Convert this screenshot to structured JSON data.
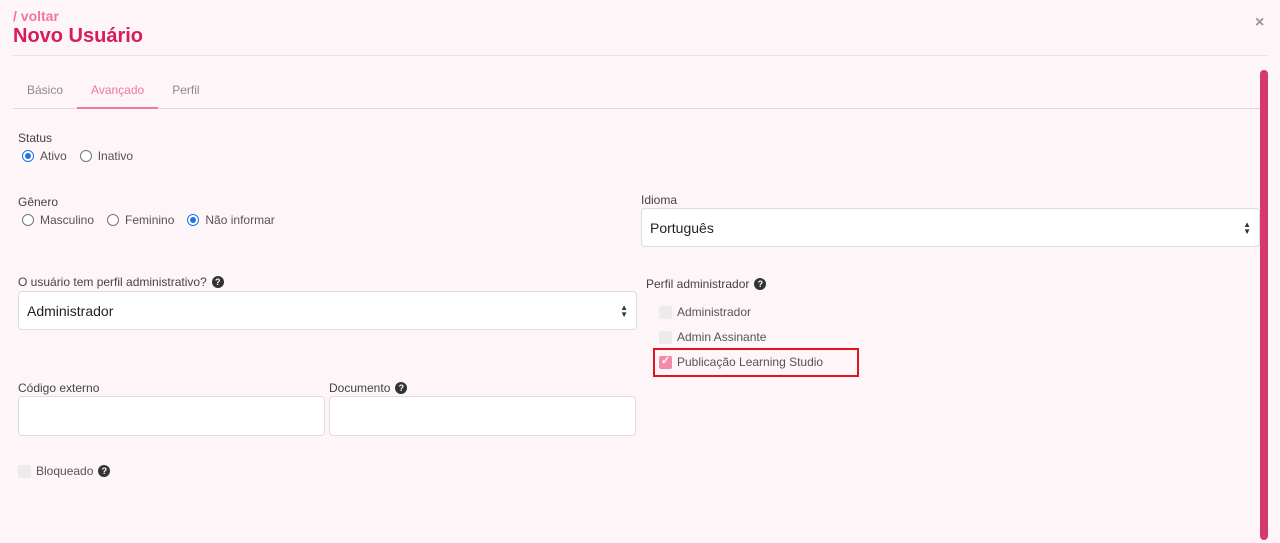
{
  "header": {
    "back_label": "/ voltar",
    "title": "Novo Usuário",
    "close_label": "×"
  },
  "tabs": [
    {
      "label": "Básico",
      "active": false
    },
    {
      "label": "Avançado",
      "active": true
    },
    {
      "label": "Perfil",
      "active": false
    }
  ],
  "status": {
    "label": "Status",
    "options": [
      {
        "label": "Ativo",
        "checked": true
      },
      {
        "label": "Inativo",
        "checked": false
      }
    ]
  },
  "genero": {
    "label": "Gênero",
    "options": [
      {
        "label": "Masculino",
        "checked": false
      },
      {
        "label": "Feminino",
        "checked": false
      },
      {
        "label": "Não informar",
        "checked": true
      }
    ]
  },
  "idioma": {
    "label": "Idioma",
    "value": "Português"
  },
  "admin_question": {
    "label": "O usuário tem perfil administrativo?",
    "value": "Administrador"
  },
  "perfil_admin": {
    "label": "Perfil administrador",
    "options": [
      {
        "label": "Administrador",
        "checked": false
      },
      {
        "label": "Admin Assinante",
        "checked": false
      },
      {
        "label": "Publicação Learning Studio",
        "checked": true
      }
    ]
  },
  "codigo_externo": {
    "label": "Código externo",
    "value": ""
  },
  "documento": {
    "label": "Documento",
    "value": ""
  },
  "bloqueado": {
    "label": "Bloqueado",
    "checked": false
  },
  "colors": {
    "accent": "#d81b5e",
    "accent_light": "#f0779e",
    "highlight": "#e0141e",
    "background": "#fdf5f8"
  }
}
